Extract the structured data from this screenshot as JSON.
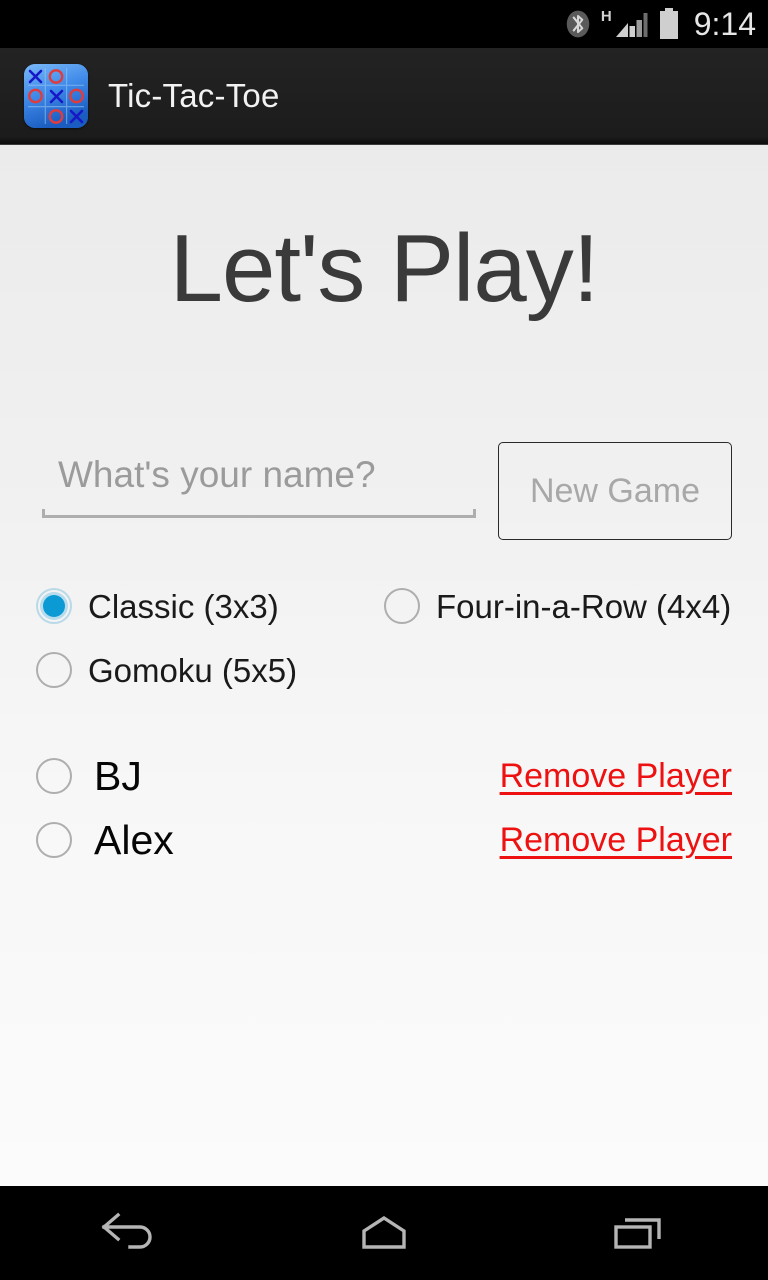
{
  "status_bar": {
    "bluetooth_icon": "bluetooth-icon",
    "network_type": "H",
    "signal_icon": "signal-bars-icon",
    "battery_icon": "battery-icon",
    "time": "9:14"
  },
  "action_bar": {
    "app_icon": "tic-tac-toe-app-icon",
    "title": "Tic-Tac-Toe",
    "background_color": "#1f1f1f"
  },
  "main": {
    "page_title": "Let's Play!",
    "name_input": {
      "value": "",
      "placeholder": "What's your name?"
    },
    "new_game_button": {
      "label": "New Game",
      "enabled": false,
      "text_color": "#a8a8a8"
    },
    "game_modes": {
      "selected": "Classic (3x3)",
      "accent_color": "#0c9ad4",
      "options": [
        {
          "label": "Classic (3x3)",
          "checked": true
        },
        {
          "label": "Four-in-a-Row (4x4)",
          "checked": false
        },
        {
          "label": "Gomoku (5x5)",
          "checked": false
        }
      ]
    },
    "players": {
      "remove_link_color": "#ee1111",
      "rows": [
        {
          "name": "BJ",
          "checked": false,
          "remove_label": "Remove Player"
        },
        {
          "name": "Alex",
          "checked": false,
          "remove_label": "Remove Player"
        }
      ]
    }
  },
  "nav_bar": {
    "back": "back-icon",
    "home": "home-icon",
    "recents": "recents-icon"
  }
}
